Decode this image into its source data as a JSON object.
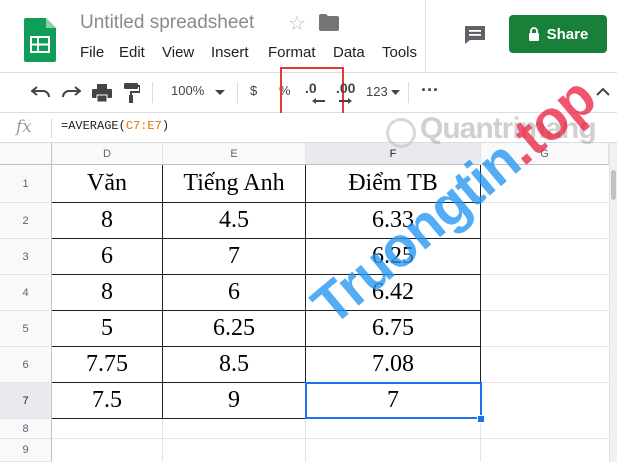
{
  "header": {
    "doc_title": "Untitled spreadsheet",
    "menu": [
      "File",
      "Edit",
      "View",
      "Insert",
      "Format",
      "Data",
      "Tools"
    ],
    "share_label": "Share",
    "share_color": "#188038"
  },
  "toolbar": {
    "zoom": "100%",
    "currency": "$",
    "percent": "%",
    "decrease_decimal": ".0",
    "increase_decimal": ".00",
    "more_formats": "123",
    "more": "···"
  },
  "formula_bar": {
    "fx": "fx",
    "prefix": "=AVERAGE(",
    "range": "C7:E7",
    "suffix": ")"
  },
  "grid": {
    "columns": [
      "D",
      "E",
      "F",
      "G"
    ],
    "rows": [
      "1",
      "2",
      "3",
      "4",
      "5",
      "6",
      "7",
      "8",
      "9"
    ],
    "table": [
      [
        "Văn",
        "Tiếng Anh",
        "Điểm TB"
      ],
      [
        "8",
        "4.5",
        "6.33"
      ],
      [
        "6",
        "7",
        "6.25"
      ],
      [
        "8",
        "6",
        "6.42"
      ],
      [
        "5",
        "6.25",
        "6.75"
      ],
      [
        "7.75",
        "8.5",
        "7.08"
      ],
      [
        "7.5",
        "9",
        "7"
      ]
    ],
    "selected_cell": "F7",
    "selection_color": "#1a73e8"
  },
  "watermark": {
    "logo": "Quantrimang",
    "diagonal_main": "Truongtin",
    "diagonal_tld": ".top"
  }
}
